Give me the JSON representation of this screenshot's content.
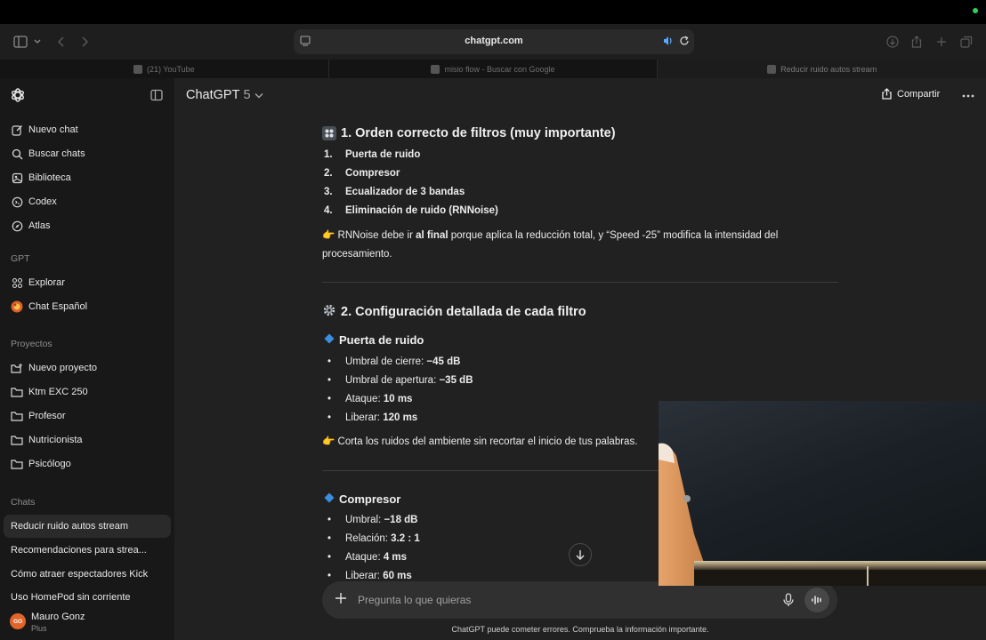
{
  "browser": {
    "url": "chatgpt.com",
    "tabs": [
      {
        "label": "(21) YouTube"
      },
      {
        "label": "misio flow - Buscar con Google"
      },
      {
        "label": "Reducir ruido autos stream"
      }
    ]
  },
  "sidebar": {
    "actions": [
      {
        "label": "Nuevo chat",
        "icon": "edit-icon"
      },
      {
        "label": "Buscar chats",
        "icon": "search-icon"
      },
      {
        "label": "Biblioteca",
        "icon": "library-icon"
      },
      {
        "label": "Codex",
        "icon": "codex-icon"
      },
      {
        "label": "Atlas",
        "icon": "compass-icon"
      }
    ],
    "gpt_section": "GPT",
    "gpt_items": [
      {
        "label": "Explorar",
        "icon": "grid-icon"
      },
      {
        "label": "Chat Español",
        "icon": "gpt-avatar-icon"
      }
    ],
    "projects_section": "Proyectos",
    "projects": [
      {
        "label": "Nuevo proyecto",
        "icon": "new-folder-icon"
      },
      {
        "label": "Ktm EXC 250",
        "icon": "folder-icon"
      },
      {
        "label": "Profesor",
        "icon": "folder-icon"
      },
      {
        "label": "Nutricionista",
        "icon": "folder-icon"
      },
      {
        "label": "Psicólogo",
        "icon": "folder-icon"
      }
    ],
    "chats_section": "Chats",
    "chats": [
      {
        "label": "Reducir ruido autos stream",
        "active": true
      },
      {
        "label": "Recomendaciones para strea..."
      },
      {
        "label": "Cómo atraer espectadores Kick"
      },
      {
        "label": "Uso HomePod sin corriente"
      }
    ],
    "user": {
      "initials": "GO",
      "name": "Mauro Gonz",
      "plan": "Plus"
    }
  },
  "header": {
    "model_name": "ChatGPT",
    "model_version": "5",
    "share_label": "Compartir"
  },
  "content": {
    "section1_title": "1. Orden correcto de filtros (muy importante)",
    "order": [
      {
        "n": "1.",
        "label": "Puerta de ruido"
      },
      {
        "n": "2.",
        "label": "Compresor"
      },
      {
        "n": "3.",
        "label": "Ecualizador de 3 bandas"
      },
      {
        "n": "4.",
        "label": "Eliminación de ruido (RNNoise)"
      }
    ],
    "note1": {
      "pre": "RNNoise debe ir ",
      "bold": "al final",
      "post": " porque aplica la reducción total, y “Speed -25” modifica la intensidad del procesamiento."
    },
    "section2_title": "2. Configuración detallada de cada filtro",
    "gate_title": "Puerta de ruido",
    "gate": [
      {
        "label": "Umbral de cierre: ",
        "value": "−45 dB"
      },
      {
        "label": "Umbral de apertura: ",
        "value": "−35 dB"
      },
      {
        "label": "Ataque: ",
        "value": "10 ms"
      },
      {
        "label": "Liberar: ",
        "value": "120 ms"
      }
    ],
    "note2": "Corta los ruidos del ambiente sin recortar el inicio de tus palabras.",
    "compressor_title": "Compresor",
    "compressor": [
      {
        "label": "Umbral: ",
        "value": "−18 dB"
      },
      {
        "label": "Relación: ",
        "value": "3.2 : 1"
      },
      {
        "label": "Ataque: ",
        "value": "4 ms"
      },
      {
        "label": "Liberar: ",
        "value": "60 ms"
      }
    ]
  },
  "composer": {
    "placeholder": "Pregunta lo que quieras"
  },
  "disclaimer": "ChatGPT puede cometer errores. Comprueba la información importante.",
  "colors": {
    "sidebar_bg": "#181818",
    "main_bg": "#212121",
    "composer_bg": "#303030",
    "accent_speaker": "#5aa9ff"
  }
}
